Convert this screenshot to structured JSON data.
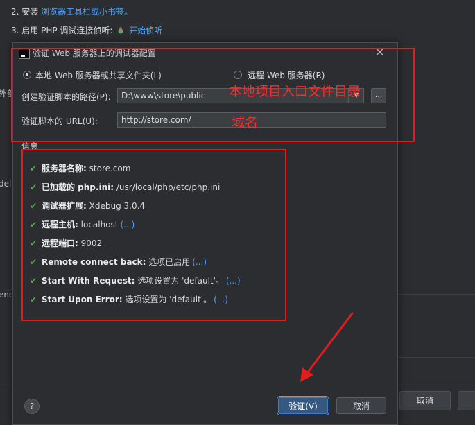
{
  "background": {
    "step2_prefix": "2. 安装",
    "step2_link": "浏览器工具栏或小书签。",
    "step3_prefix": "3. 启用 PHP 调试连接侦听:",
    "step3_link": "开始侦听",
    "side_fragments": [
      "外部",
      "del",
      "end"
    ],
    "cancel_button": "取消"
  },
  "dialog": {
    "title": "验证 Web 服务器上的调试器配置",
    "radio_local": "本地 Web 服务器或共享文件夹(L)",
    "radio_remote": "远程 Web 服务器(R)",
    "path_label": "创建验证脚本的路径(P):",
    "path_value": "D:\\www\\store\\public",
    "dots_label": "...",
    "url_label": "验证脚本的 URL(U):",
    "url_value": "http://store.com/",
    "info_heading": "信息",
    "info": [
      {
        "key": "服务器名称:",
        "value": "store.com",
        "more": ""
      },
      {
        "key": "已加载的 php.ini:",
        "value": "/usr/local/php/etc/php.ini",
        "more": ""
      },
      {
        "key": "调试器扩展:",
        "value": "Xdebug 3.0.4",
        "more": ""
      },
      {
        "key": "远程主机:",
        "value": "localhost",
        "more": "(...)"
      },
      {
        "key": "远程端口:",
        "value": "9002",
        "more": ""
      },
      {
        "key": "Remote connect back:",
        "value": "选项已启用",
        "more": "(...)"
      },
      {
        "key": "Start With Request:",
        "value": "选项设置为 'default'。",
        "more": "(...)"
      },
      {
        "key": "Start Upon Error:",
        "value": "选项设置为 'default'。",
        "more": "(...)"
      }
    ],
    "help_label": "?",
    "verify_button": "验证(V)",
    "cancel_button": "取消"
  },
  "annotations": {
    "entry_dir": "本地项目入口文件目录",
    "domain": "域名"
  },
  "colors": {
    "annotation": "#e11d1d",
    "link": "#4aa3ff",
    "check": "#4caf50",
    "primary_button": "#365880"
  }
}
